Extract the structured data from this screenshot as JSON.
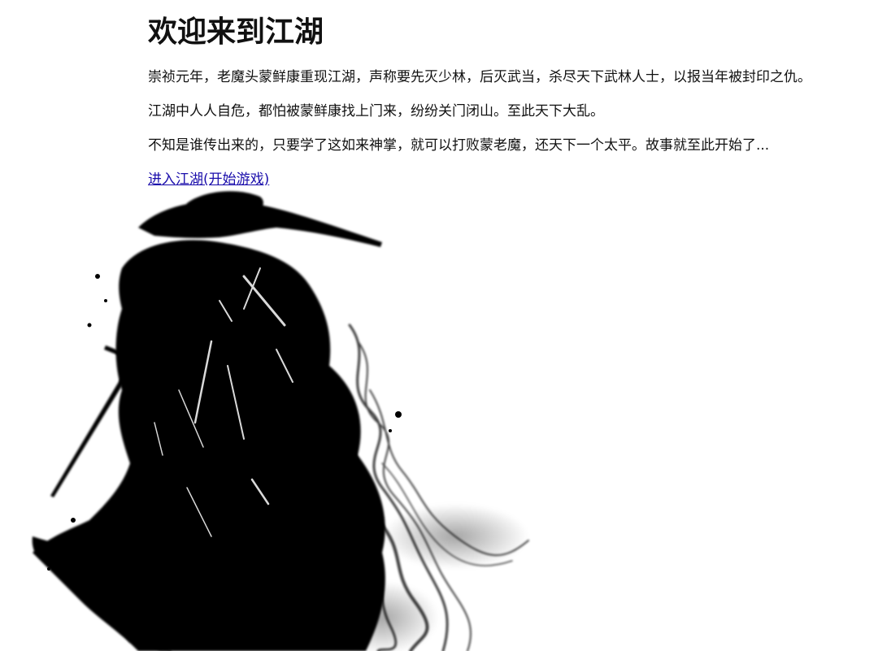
{
  "page": {
    "title": "欢迎来到江湖"
  },
  "story": {
    "paragraphs": [
      "崇祯元年，老魔头蒙鲜康重现江湖，声称要先灭少林，后灭武当，杀尽天下武林人士，以报当年被封印之仇。",
      "江湖中人人自危，都怕被蒙鲜康找上门来，纷纷关门闭山。至此天下大乱。",
      "不知是谁传出来的，只要学了这如来神掌，就可以打败蒙老魔，还天下一个太平。故事就至此开始了..."
    ]
  },
  "actions": {
    "enter_link": "进入江湖(开始游戏)"
  },
  "colors": {
    "link": "#1a0dab",
    "ink": "#000000",
    "background": "#ffffff"
  },
  "illustration": {
    "icon": "ink-swordsman-icon"
  }
}
